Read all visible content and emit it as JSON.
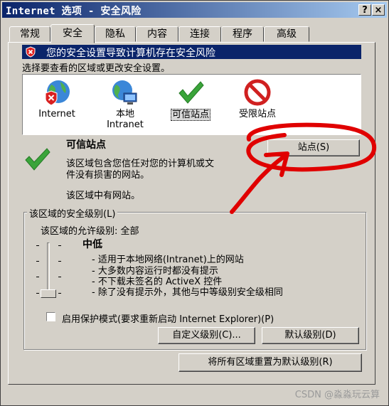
{
  "window": {
    "title": "Internet 选项 - 安全风险",
    "help_button": "?",
    "close_button": "×"
  },
  "tabs": [
    {
      "label": "常规"
    },
    {
      "label": "安全"
    },
    {
      "label": "隐私"
    },
    {
      "label": "内容"
    },
    {
      "label": "连接"
    },
    {
      "label": "程序"
    },
    {
      "label": "高级"
    }
  ],
  "warning_banner": "您的安全设置导致计算机存在安全风险",
  "zone_prompt": "选择要查看的区域或更改安全设置。",
  "zones": [
    {
      "label": "Internet",
      "icon": "globe-blocked-icon"
    },
    {
      "label": "本地\nIntranet",
      "icon": "globe-network-icon"
    },
    {
      "label": "可信站点",
      "icon": "checkmark-icon",
      "selected": true
    },
    {
      "label": "受限站点",
      "icon": "restricted-icon"
    }
  ],
  "zone_info": {
    "title": "可信站点",
    "description_line1": "该区域包含您信任对您的计算机或文",
    "description_line2": "件没有损害的网站。",
    "status": "该区域中有网站。",
    "sites_button": "站点(S)"
  },
  "security_level": {
    "group_title": "该区域的安全级别(L)",
    "allowed_levels": "该区域的允许级别: 全部",
    "level_name": "中低",
    "bullets": [
      "- 适用于本地网络(Intranet)上的网站",
      "- 大多数内容运行时都没有提示",
      "- 不下载未签名的 ActiveX 控件",
      "- 除了没有提示外，其他与中等级别安全级相同"
    ],
    "protected_mode_label": "启用保护模式(要求重新启动 Internet Explorer)(P)",
    "protected_mode_checked": false,
    "custom_level_button": "自定义级别(C)...",
    "default_level_button": "默认级别(D)"
  },
  "reset_all_button": "将所有区域重置为默认级别(R)",
  "watermark": "CSDN @淼淼玩云算",
  "colors": {
    "title_bar": "#0a246a",
    "warning_banner": "#0a246a",
    "window_face": "#d4d0c8",
    "annotation_red": "#e00000",
    "check_green": "#3aa43a"
  }
}
